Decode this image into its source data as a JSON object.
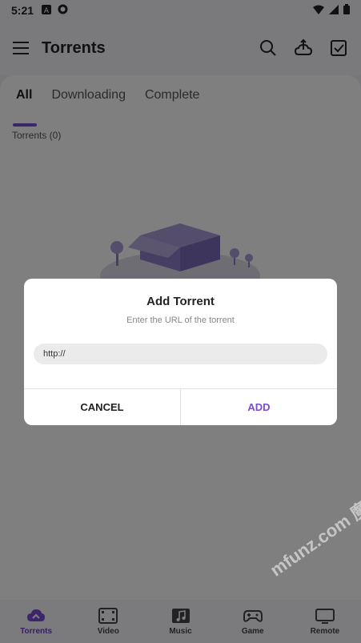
{
  "status_bar": {
    "time": "5:21"
  },
  "app_bar": {
    "title": "Torrents"
  },
  "tabs": [
    {
      "label": "All",
      "active": true
    },
    {
      "label": "Downloading",
      "active": false
    },
    {
      "label": "Complete",
      "active": false
    }
  ],
  "torrent_list": {
    "count_label": "Torrents (0)"
  },
  "bottom_nav": [
    {
      "label": "Torrents",
      "icon": "torrent-cloud-icon",
      "active": true
    },
    {
      "label": "Video",
      "icon": "film-icon",
      "active": false
    },
    {
      "label": "Music",
      "icon": "music-icon",
      "active": false
    },
    {
      "label": "Game",
      "icon": "gamepad-icon",
      "active": false
    },
    {
      "label": "Remote",
      "icon": "remote-icon",
      "active": false
    }
  ],
  "dialog": {
    "title": "Add Torrent",
    "subtitle": "Enter the URL of the torrent",
    "url_value": "http://",
    "cancel_label": "CANCEL",
    "add_label": "ADD"
  },
  "watermark": "mfunz.com 魔趣网",
  "colors": {
    "accent": "#7b4bd6",
    "scrim": "rgba(0,0,0,0.5)"
  }
}
